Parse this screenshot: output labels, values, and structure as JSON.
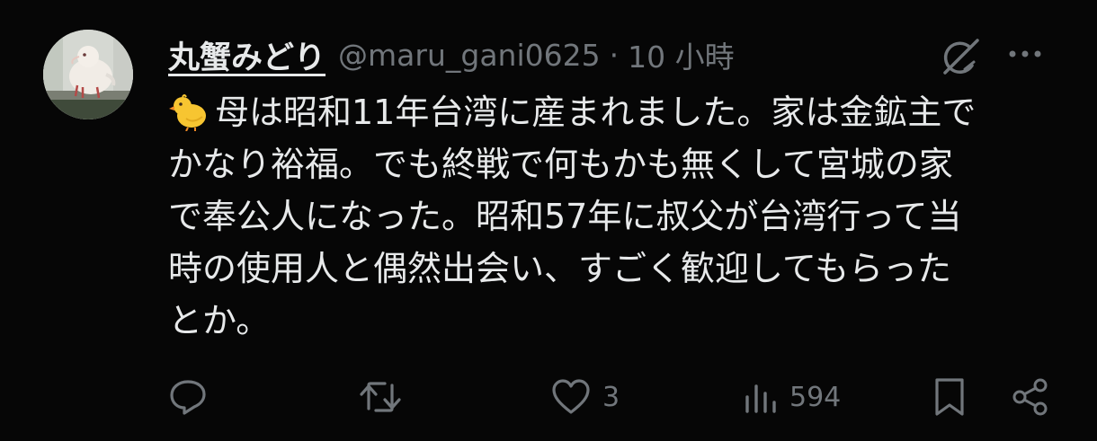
{
  "tweet": {
    "display_name": "丸蟹みどり",
    "handle": "@maru_gani0625",
    "separator": "·",
    "time": "10 小時",
    "body_lines": [
      "母は昭和11年台湾に産まれました。家は金鉱主で",
      "かなり裕福。でも終戦で何もかも無くして宮城の家",
      "で奉公人になった。昭和57年に叔父が台湾行って当",
      "時の使用人と偶然出会い、すごく歓迎してもらった",
      "とか。"
    ],
    "leading_emoji": "chick-emoji"
  },
  "actions": {
    "reply": {
      "icon": "reply-icon"
    },
    "repost": {
      "icon": "repost-icon"
    },
    "like": {
      "icon": "heart-icon",
      "count": "3"
    },
    "views": {
      "icon": "views-icon",
      "count": "594"
    },
    "bookmark": {
      "icon": "bookmark-icon"
    },
    "share": {
      "icon": "share-icon"
    }
  },
  "colors": {
    "background": "#060606",
    "text_primary": "#e7e9ea",
    "text_secondary": "#71767b"
  }
}
